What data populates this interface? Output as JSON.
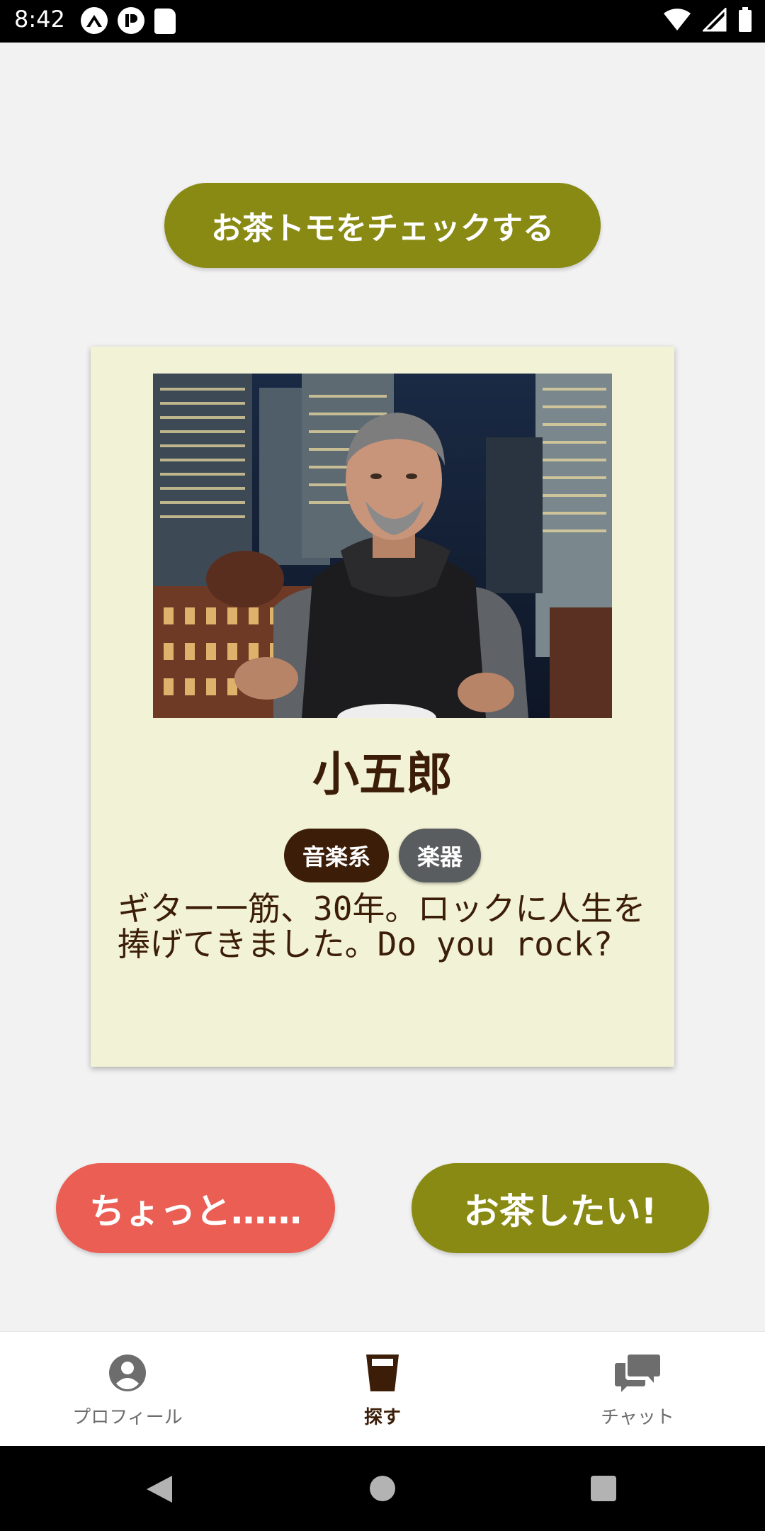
{
  "status_bar": {
    "time": "8:42",
    "icons_left": [
      "a-notification-icon",
      "p-notification-icon",
      "sd-card-icon"
    ],
    "icons_right": [
      "wifi-icon",
      "signal-icon",
      "battery-icon"
    ]
  },
  "header": {
    "check_button_label": "お茶トモをチェックする"
  },
  "profile_card": {
    "photo_alt": "profile-photo",
    "name": "小五郎",
    "tags": [
      "音楽系",
      "楽器"
    ],
    "bio": "ギター一筋、30年。ロックに人生を捧げてきました。Do you rock?"
  },
  "actions": {
    "decline_label": "ちょっと……",
    "accept_label": "お茶したい!"
  },
  "bottom_nav": {
    "items": [
      {
        "label": "プロフィール",
        "icon": "person-icon"
      },
      {
        "label": "探す",
        "icon": "cup-icon",
        "active": true
      },
      {
        "label": "チャット",
        "icon": "chat-icon"
      }
    ]
  },
  "colors": {
    "olive": "#898a13",
    "coral": "#ea5e54",
    "brown": "#3b1d08",
    "card_bg": "#f2f2d6",
    "gray_tag": "#5a5d5f"
  }
}
